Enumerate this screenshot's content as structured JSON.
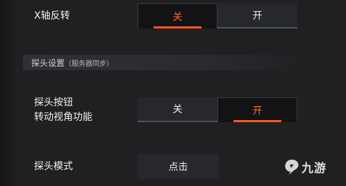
{
  "settings": {
    "x_axis_invert": {
      "label": "X轴反转",
      "options": [
        "关",
        "开"
      ],
      "selected": "关"
    },
    "section": {
      "title": "探头设置",
      "subtitle": "（服务器同步）"
    },
    "probe_view_button": {
      "label_line1": "探头按钮",
      "label_line2": "转动视角功能",
      "options": [
        "关",
        "开"
      ],
      "selected": "开"
    },
    "probe_mode": {
      "label": "探头模式",
      "value": "点击"
    }
  },
  "watermark": {
    "text": "九游",
    "icon": "jiuyou-logo-icon"
  },
  "colors": {
    "accent": "#ff5a1f",
    "selected_text": "#ff6a2b",
    "background": "#1e2022",
    "button_bg": "#26282b"
  }
}
